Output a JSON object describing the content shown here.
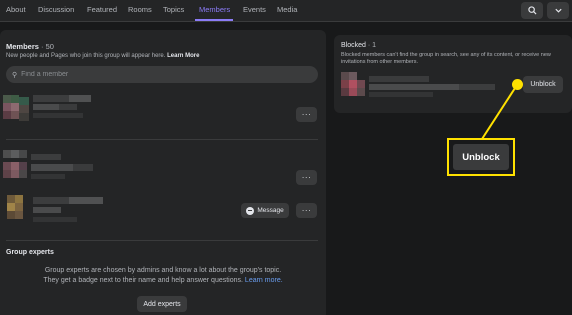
{
  "nav": {
    "tabs": [
      {
        "label": "About"
      },
      {
        "label": "Discussion"
      },
      {
        "label": "Featured"
      },
      {
        "label": "Rooms"
      },
      {
        "label": "Topics"
      },
      {
        "label": "Members",
        "active": true
      },
      {
        "label": "Events"
      },
      {
        "label": "Media"
      }
    ],
    "search_icon": "search-icon",
    "more_icon": "more-icon",
    "accent": "#8b7cf6"
  },
  "members": {
    "title": "Members",
    "count": "· 50",
    "subtitle": "New people and Pages who join this group will appear here.",
    "learn_more": "Learn More",
    "search_placeholder": "Find a member",
    "more_label": "···",
    "message_label": "Message"
  },
  "experts": {
    "title": "Group experts",
    "line1": "Group experts are chosen by admins and know a lot about the group's topic.",
    "line2": "They get a badge next to their name and help answer questions.",
    "learn_more": "Learn more.",
    "add_label": "Add experts"
  },
  "blocked": {
    "title": "Blocked",
    "count": "· 1",
    "line1": "Blocked members can't find the group in search, see any of its content, or receive new",
    "line2": "invitations from other members.",
    "unblock_label": "Unblock"
  },
  "callout": {
    "label": "Unblock",
    "color": "#ffe100"
  }
}
